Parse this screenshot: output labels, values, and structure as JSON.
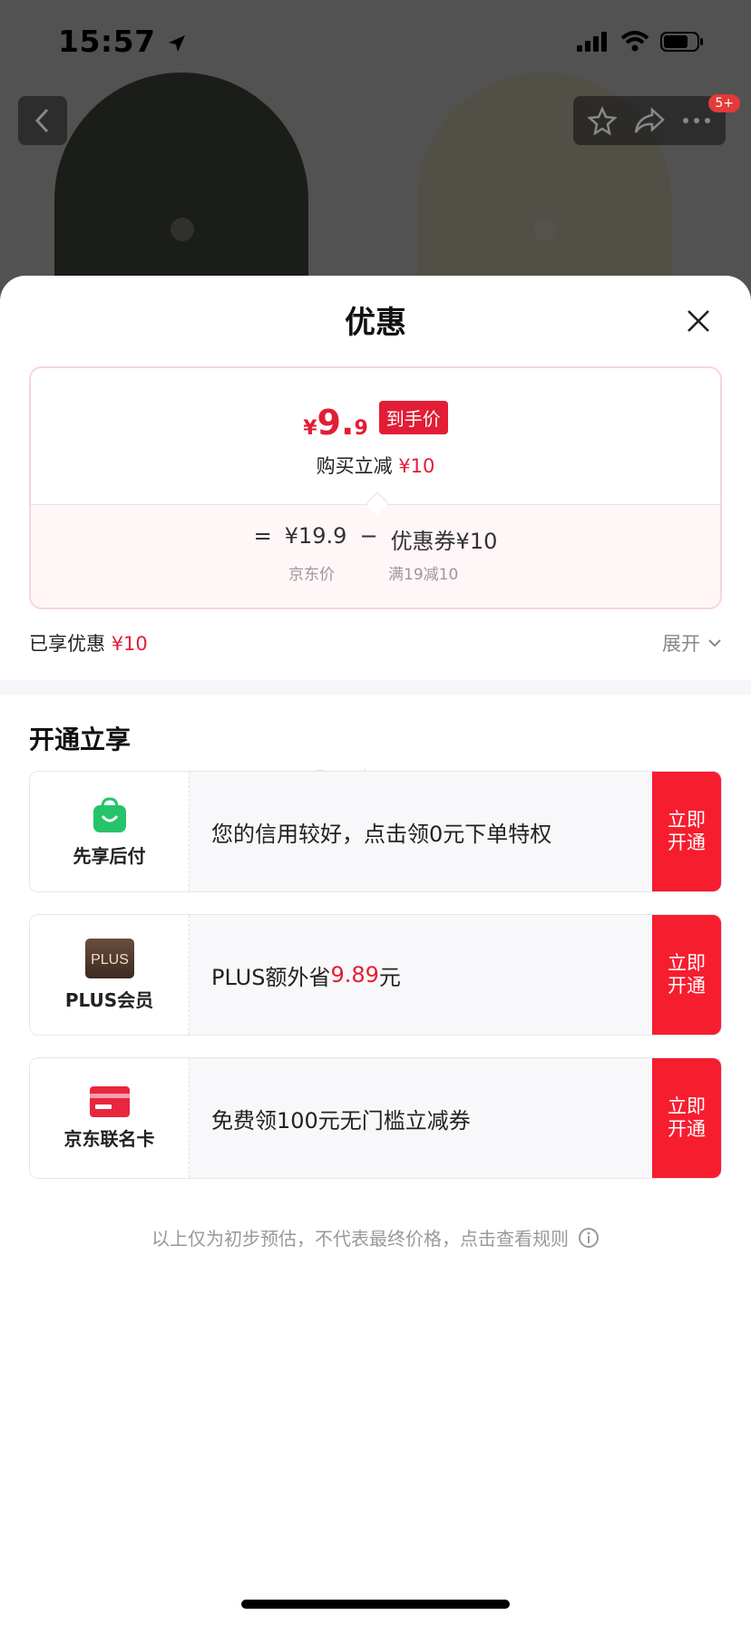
{
  "status_bar": {
    "time": "15:57"
  },
  "nav": {
    "badge": "5+"
  },
  "sheet": {
    "title": "优惠",
    "price_card": {
      "currency": "¥",
      "price_int": "9.",
      "price_dec": "9",
      "tag": "到手价",
      "sub_prefix": "购买立减 ",
      "sub_value": "¥10",
      "formula": [
        "=",
        "¥19.9",
        "−",
        "优惠券¥10"
      ],
      "label_price": "京东价",
      "label_coupon": "满19减10"
    },
    "enjoyed": {
      "label": "已享优惠 ",
      "value": "¥10"
    },
    "expand_label": "展开",
    "section_title": "开通立享",
    "watermark": "Gemine",
    "offers": [
      {
        "name": "先享后付",
        "text": "您的信用较好，点击领0元下单特权",
        "button_line1": "立即",
        "button_line2": "开通",
        "icon": "shopping-bag-icon"
      },
      {
        "name": "PLUS会员",
        "text_prefix": "PLUS额外省",
        "text_value": "9.89",
        "text_suffix": "元",
        "button_line1": "立即",
        "button_line2": "开通",
        "icon": "plus-badge-icon",
        "icon_text": "PLUS"
      },
      {
        "name": "京东联名卡",
        "text": "免费领100元无门槛立减券",
        "button_line1": "立即",
        "button_line2": "开通",
        "icon": "credit-card-icon"
      }
    ],
    "note": "以上仅为初步预估，不代表最终价格，点击查看规则"
  },
  "colors": {
    "accent_red": "#e31d35",
    "button_red": "#f61d2f",
    "green": "#25c46a"
  }
}
